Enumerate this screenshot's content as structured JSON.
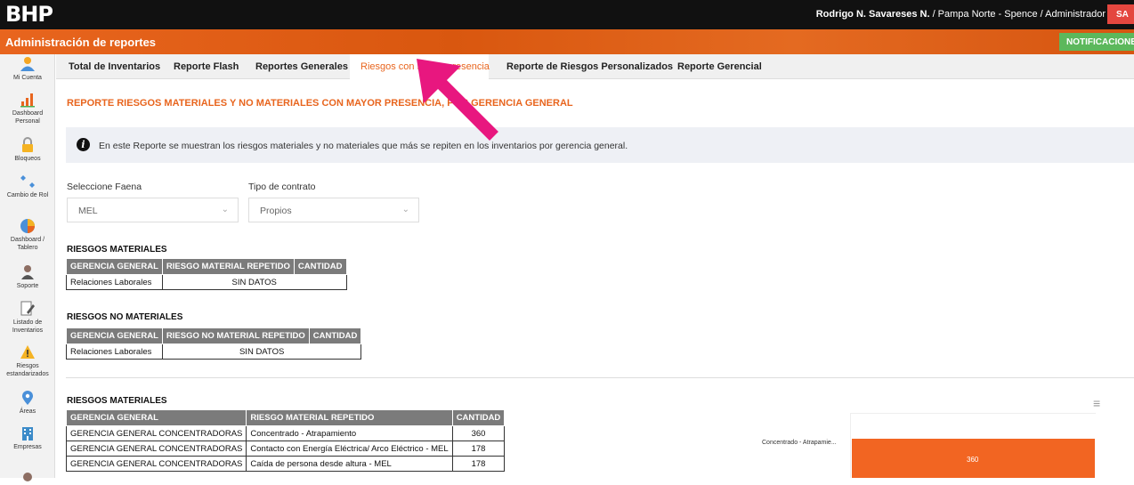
{
  "header": {
    "brand": "BHP",
    "user_name": "Rodrigo N. Savareses N.",
    "user_context": " / Pampa Norte - Spence / Administrador",
    "logout_label": "SA"
  },
  "subheader": {
    "title": "Administración de reportes",
    "notifications_label": "NOTIFICACIONE"
  },
  "sidebar": {
    "items": [
      {
        "label": "Mi Cuenta",
        "icon": "user-icon"
      },
      {
        "label": "Dashboard Personal",
        "icon": "bar-chart-icon"
      },
      {
        "label": "Bloqueos",
        "icon": "lock-icon"
      },
      {
        "label": "Cambio de Rol",
        "icon": "swap-icon"
      },
      {
        "label": "Dashboard / Tablero",
        "icon": "pie-chart-icon"
      },
      {
        "label": "Soporte",
        "icon": "support-person-icon"
      },
      {
        "label": "Listado de Inventarios",
        "icon": "edit-document-icon"
      },
      {
        "label": "Riesgos estandarizados",
        "icon": "warning-icon"
      },
      {
        "label": "Áreas",
        "icon": "map-pin-icon"
      },
      {
        "label": "Empresas",
        "icon": "building-icon"
      }
    ]
  },
  "tabs": [
    {
      "label": "Total de Inventarios"
    },
    {
      "label": "Reporte Flash"
    },
    {
      "label": "Reportes Generales"
    },
    {
      "label": "Riesgos con mayor presencia"
    },
    {
      "label": "Reporte de Riesgos Personalizados"
    },
    {
      "label": "Reporte Gerencial"
    }
  ],
  "report": {
    "title": "REPORTE RIESGOS MATERIALES Y NO MATERIALES CON MAYOR PRESENCIA, POR GERENCIA GENERAL",
    "info": "En este Reporte se muestran los riesgos materiales y no materiales que más se repiten en los inventarios por gerencia general."
  },
  "filters": {
    "faena_label": "Seleccione Faena",
    "faena_value": "MEL",
    "contrato_label": "Tipo de contrato",
    "contrato_value": "Propios"
  },
  "table1": {
    "title": "RIESGOS MATERIALES",
    "headers": [
      "GERENCIA GENERAL",
      "RIESGO MATERIAL REPETIDO",
      "CANTIDAD"
    ],
    "row": [
      "Relaciones Laborales",
      "SIN DATOS"
    ]
  },
  "table2": {
    "title": "RIESGOS NO MATERIALES",
    "headers": [
      "GERENCIA GENERAL",
      "RIESGO NO MATERIAL REPETIDO",
      "CANTIDAD"
    ],
    "row": [
      "Relaciones Laborales",
      "SIN DATOS"
    ]
  },
  "table3": {
    "title": "RIESGOS MATERIALES",
    "headers": [
      "GERENCIA GENERAL",
      "RIESGO MATERIAL REPETIDO",
      "CANTIDAD"
    ],
    "rows": [
      [
        "GERENCIA GENERAL CONCENTRADORAS",
        "Concentrado - Atrapamiento",
        "360"
      ],
      [
        "GERENCIA GENERAL CONCENTRADORAS",
        "Contacto con Energía Eléctrica/ Arco Eléctrico - MEL",
        "178"
      ],
      [
        "GERENCIA GENERAL CONCENTRADORAS",
        "Caída de persona desde altura - MEL",
        "178"
      ]
    ]
  },
  "chart": {
    "category_label": "Concentrado - Atrapamie...",
    "value_label": "360",
    "bar_color": "#f26522"
  }
}
